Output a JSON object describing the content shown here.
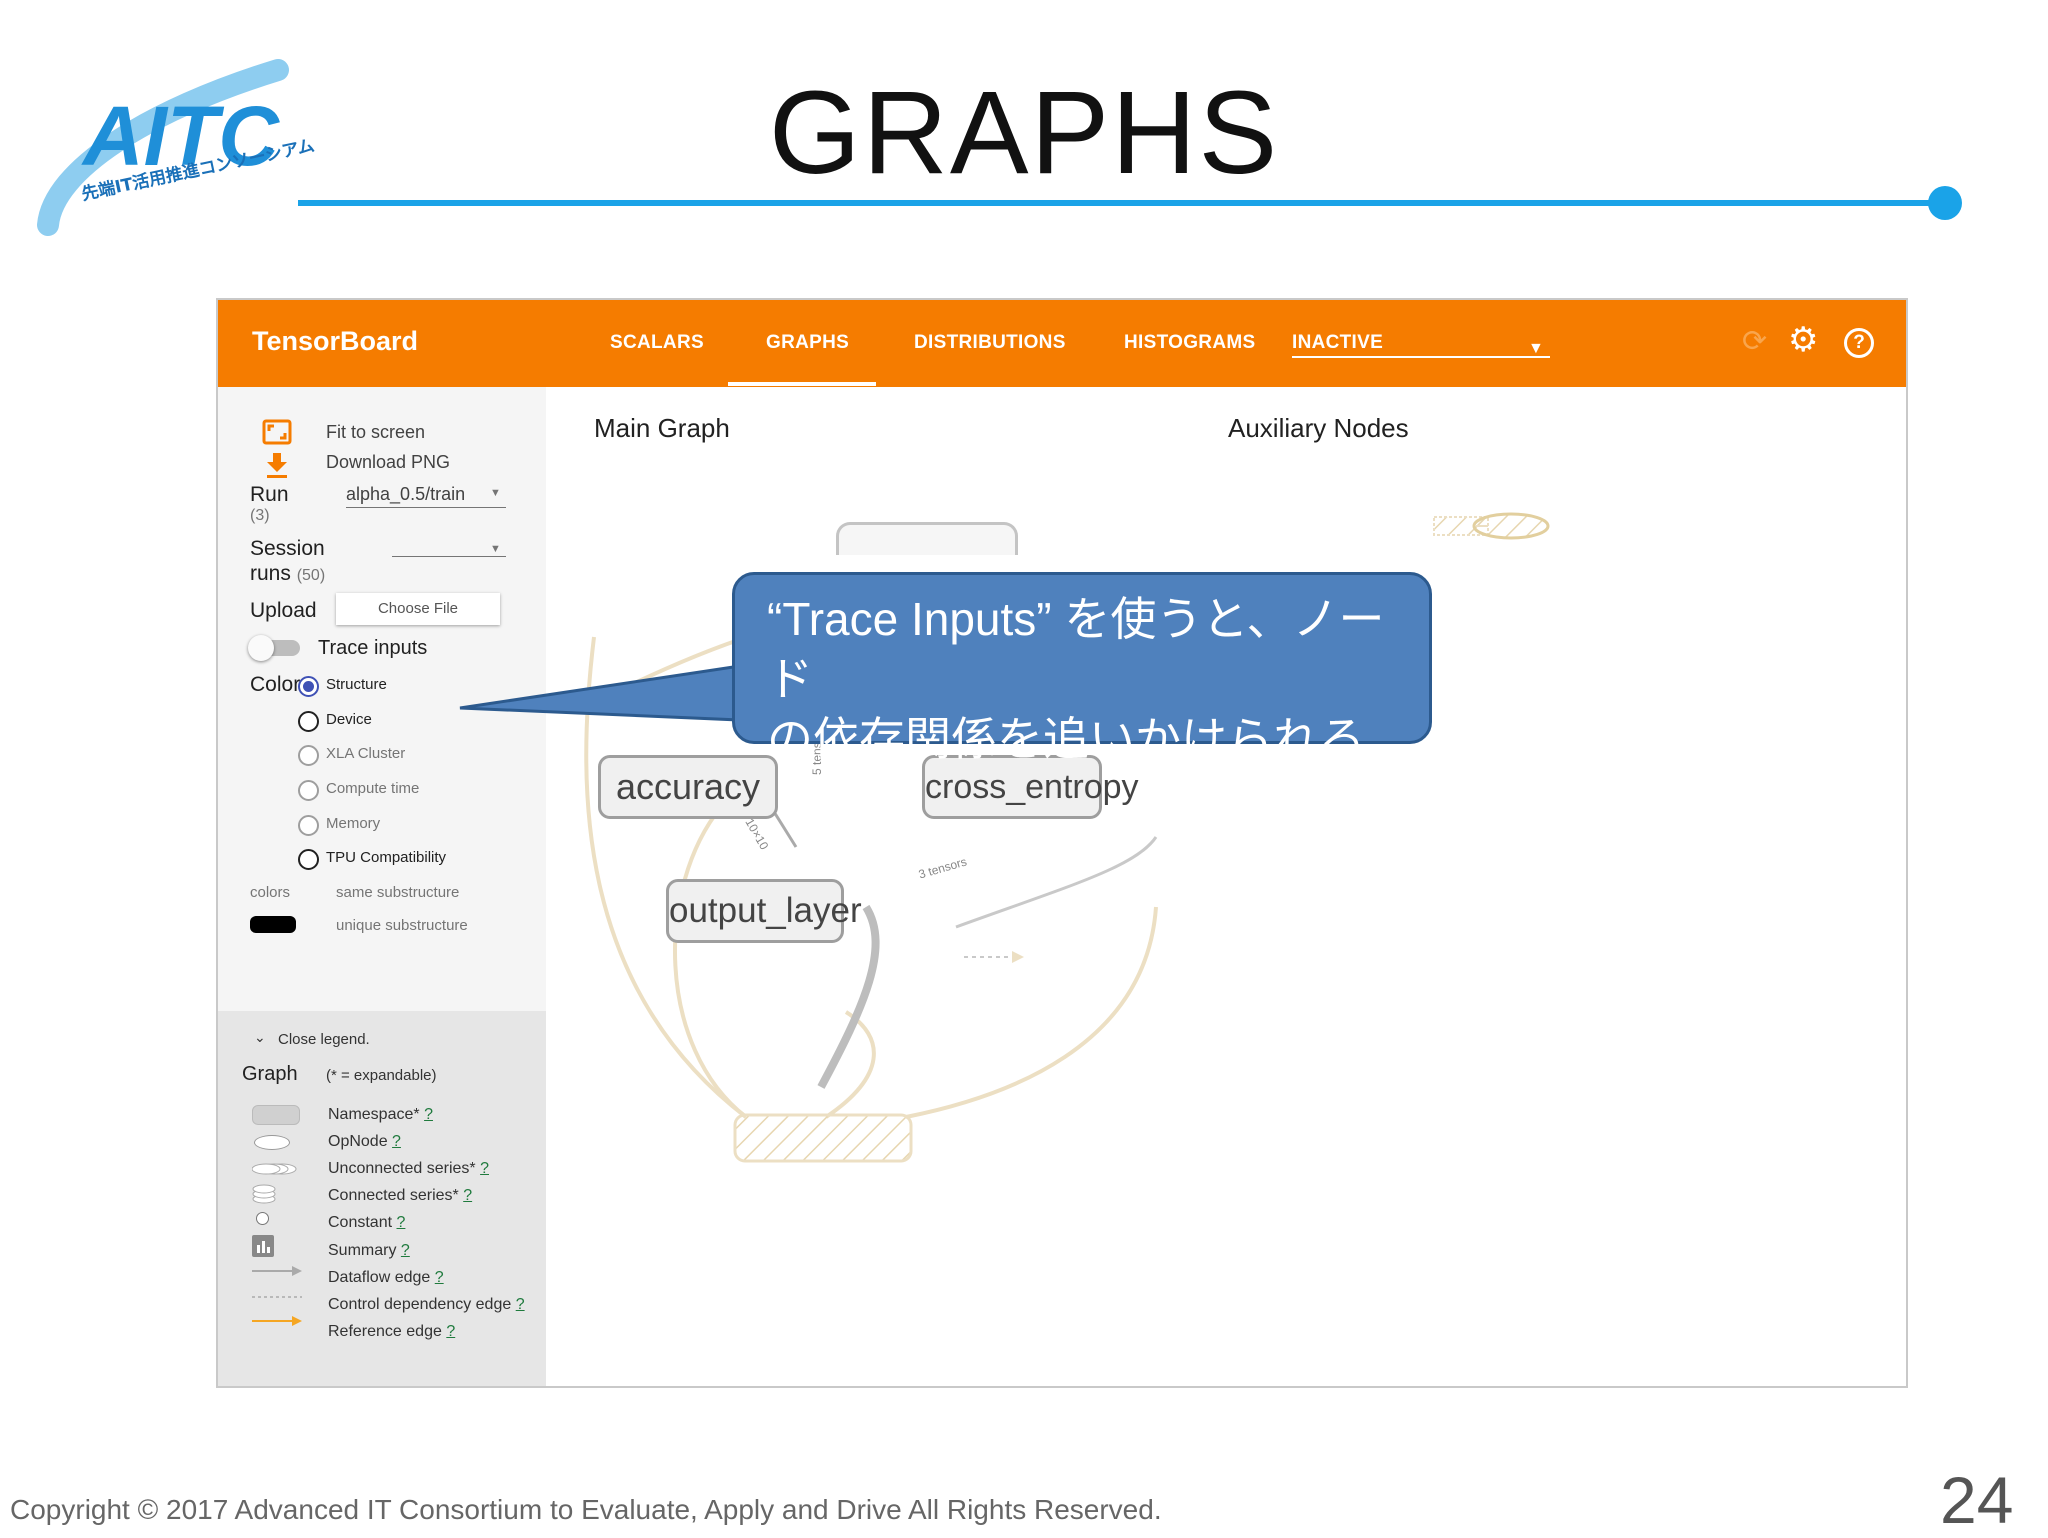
{
  "slide": {
    "title": "GRAPHS",
    "logo_text": "AITC",
    "logo_subtitle": "先端IT活用推進コンソーシアム",
    "accent_color": "#1aa3e8",
    "footer": "Copyright © 2017 Advanced IT Consortium to Evaluate, Apply and Drive All Rights Reserved.",
    "page_number": "24"
  },
  "toolbar": {
    "brand": "TensorBoard",
    "bg_color": "#f57c00",
    "tabs": [
      "SCALARS",
      "GRAPHS",
      "DISTRIBUTIONS",
      "HISTOGRAMS"
    ],
    "selected_tab": "GRAPHS",
    "inactive_dropdown": "INACTIVE",
    "icons": [
      "refresh-icon",
      "gear-icon",
      "help-icon"
    ]
  },
  "sidebar": {
    "fit_to_screen": "Fit to screen",
    "download_png": "Download PNG",
    "run_label": "Run",
    "run_count": "(3)",
    "run_value": "alpha_0.5/train",
    "session_label": "Session",
    "runs_label": "runs",
    "session_count": "(50)",
    "upload_label": "Upload",
    "choose_file": "Choose File",
    "trace_inputs": "Trace inputs",
    "color_label": "Color",
    "color_options": [
      "Structure",
      "Device",
      "XLA Cluster",
      "Compute time",
      "Memory",
      "TPU Compatibility"
    ],
    "color_selected": "Structure",
    "colors_label": "colors",
    "same_substructure": "same substructure",
    "unique_substructure": "unique substructure"
  },
  "legend": {
    "close_legend": "Close legend.",
    "graph_label": "Graph",
    "expandable_note": "(* = expandable)",
    "items": [
      "Namespace*",
      "OpNode",
      "Unconnected series*",
      "Connected series*",
      "Constant",
      "Summary",
      "Dataflow edge",
      "Control dependency edge",
      "Reference edge"
    ],
    "help_mark": "?"
  },
  "graph": {
    "main_graph_title": "Main Graph",
    "auxiliary_title": "Auxiliary Nodes",
    "nodes": [
      "accuracy",
      "cross_entropy",
      "output_layer"
    ],
    "edge_labels": [
      "5 tensors",
      "3 tensors",
      "10×10"
    ]
  },
  "callout": {
    "line1": "“Trace Inputs” を使うと、ノード",
    "line2": "の依存関係を追いかけられる",
    "color": "#4f81bd"
  }
}
